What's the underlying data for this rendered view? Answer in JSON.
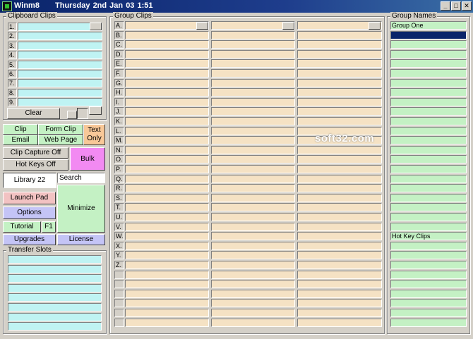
{
  "window": {
    "title": "Winm8",
    "datetime": "Thursday  2nd Jan 03   1:51",
    "controls": [
      "minimize-icon",
      "maximize-icon",
      "close-icon"
    ]
  },
  "clipboard": {
    "legend": "Clipboard Clips",
    "rows": [
      "1.",
      "2.",
      "3.",
      "4.",
      "5.",
      "6.",
      "7.",
      "8.",
      "9."
    ],
    "clear_label": "Clear"
  },
  "buttons": {
    "clip": "Clip",
    "form_clip": "Form Clip",
    "text_only_1": "Text",
    "text_only_2": "Only",
    "email": "Email",
    "web_page": "Web Page",
    "clip_capture": "Clip Capture Off",
    "hot_keys": "Hot Keys Off",
    "bulk": "Bulk",
    "library": "Library 22",
    "launch_pad": "Launch Pad",
    "options": "Options",
    "tutorial": "Tutorial",
    "f1": "F1",
    "minimize": "Minimize",
    "upgrades": "Upgrades",
    "license": "License"
  },
  "search": {
    "value": "Search"
  },
  "transfer": {
    "legend": "Transfer Slots",
    "slot_count": 8
  },
  "group_clips": {
    "legend": "Group Clips",
    "letters": [
      "A.",
      "B.",
      "C.",
      "D.",
      "E.",
      "F.",
      "G.",
      "H.",
      "I.",
      "J.",
      "K.",
      "L.",
      "M.",
      "N.",
      "O.",
      "P.",
      "Q.",
      "R.",
      "S.",
      "T.",
      "U.",
      "V.",
      "W.",
      "X.",
      "Y.",
      "Z."
    ],
    "total_rows": 32
  },
  "group_names": {
    "legend": "Group Names",
    "first": "Group One",
    "hot_key_clips": "Hot Key Clips"
  },
  "watermark": "soft32.com",
  "colors": {
    "cyan": "#bff3f3",
    "tan": "#f5e2c4",
    "green": "#c4f1c4",
    "title_bar": "#0a246a",
    "face": "#d4d0c8"
  }
}
